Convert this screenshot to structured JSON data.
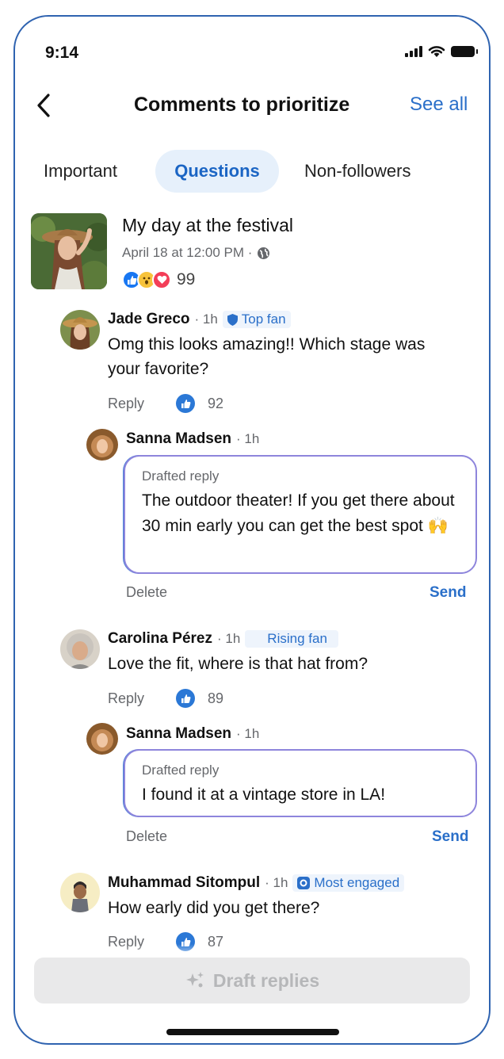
{
  "status_bar": {
    "time": "9:14"
  },
  "header": {
    "title": "Comments to prioritize",
    "see_all": "See all"
  },
  "tabs": [
    {
      "label": "Important",
      "active": false
    },
    {
      "label": "Questions",
      "active": true
    },
    {
      "label": "Non-followers",
      "active": false
    }
  ],
  "post": {
    "title": "My day at the festival",
    "date": "April 18 at 12:00 PM ·",
    "reaction_count": "99",
    "reactions": [
      "like-icon",
      "wow-icon",
      "love-icon"
    ]
  },
  "comments": [
    {
      "author": "Jade Greco",
      "time": "· 1h",
      "badge": "Top fan",
      "text": "Omg this looks amazing!! Which stage was your favorite?",
      "reply": "Reply",
      "likes": "92",
      "draft": {
        "author": "Sanna Madsen",
        "time": "· 1h",
        "label": "Drafted reply",
        "text": "The outdoor theater! If you get there about 30 min early you can get the best spot 🙌",
        "delete": "Delete",
        "send": "Send"
      }
    },
    {
      "author": "Carolina Pérez",
      "time": "· 1h",
      "badge": "Rising fan",
      "text": "Love the fit, where is that hat from?",
      "reply": "Reply",
      "likes": "89",
      "draft": {
        "author": "Sanna Madsen",
        "time": "· 1h",
        "label": "Drafted reply",
        "text": "I found it at a vintage store in LA!",
        "delete": "Delete",
        "send": "Send"
      }
    },
    {
      "author": "Muhammad Sitompul",
      "time": "· 1h",
      "badge": "Most engaged",
      "text": "How early did you get there?",
      "reply": "Reply",
      "likes": "87"
    }
  ],
  "footer": {
    "button": "Draft replies",
    "icon": "sparkle-icon"
  },
  "colors": {
    "accent": "#2a6fc9",
    "frame": "#2f63b0",
    "draft_border": "#8e85dc",
    "like": "#2b78d6"
  }
}
